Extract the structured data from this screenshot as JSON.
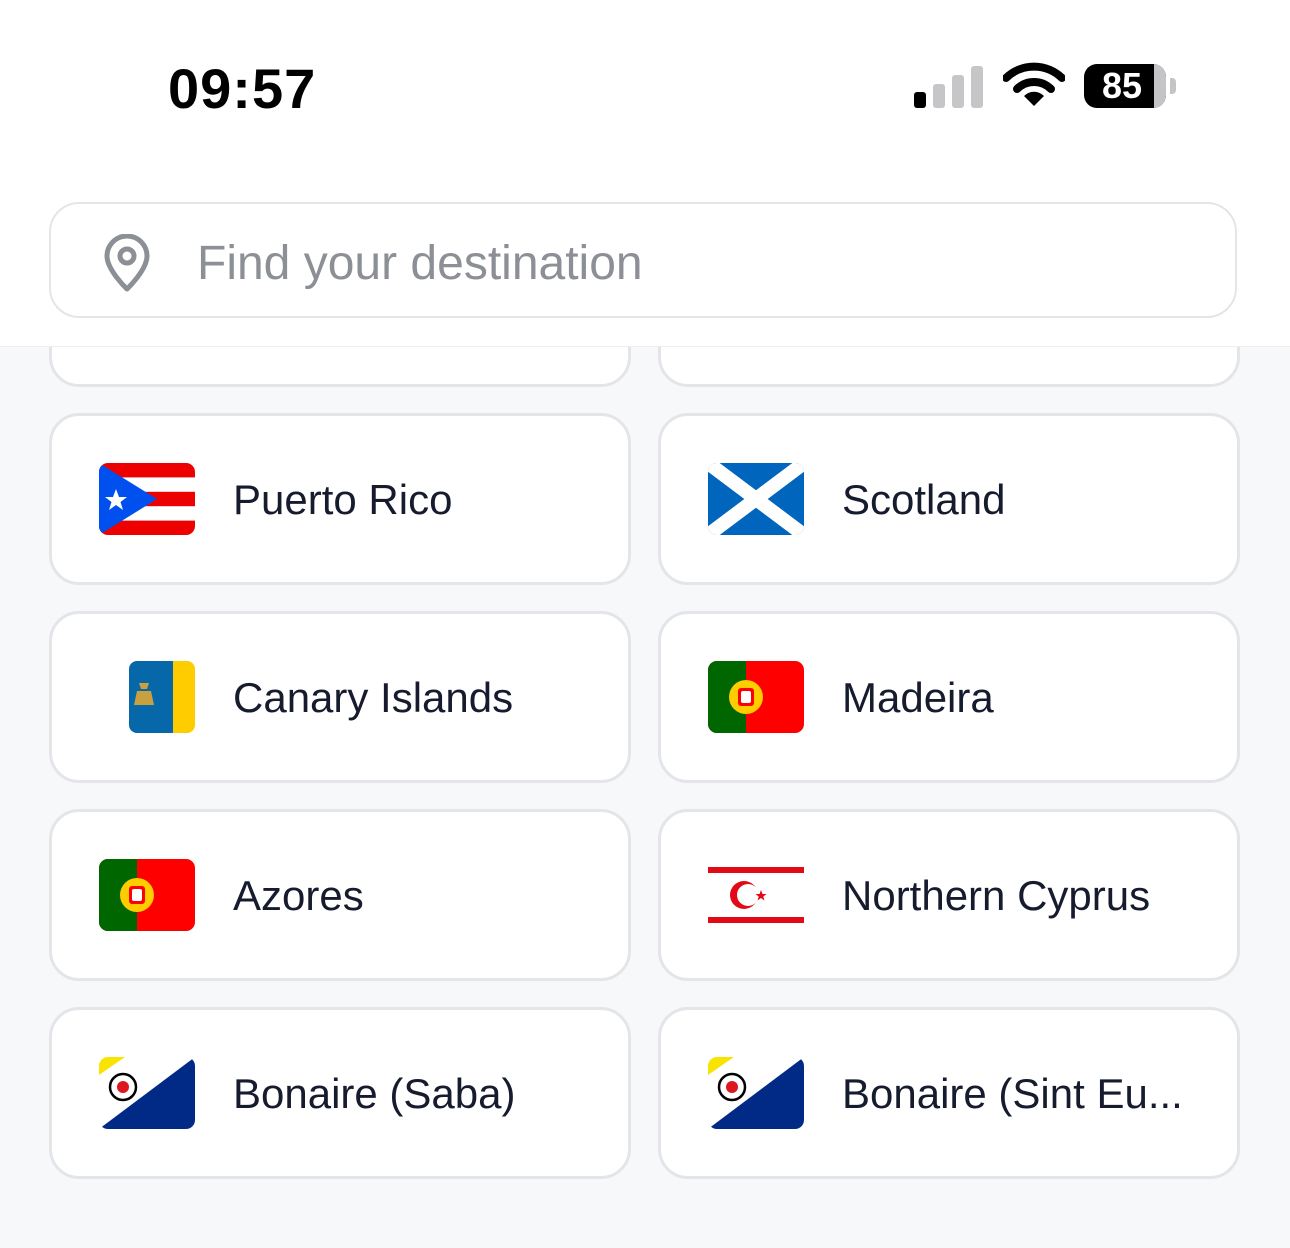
{
  "status_bar": {
    "time": "09:57",
    "battery_percent": "85",
    "signal_bars_active": 1,
    "signal_bars_total": 4
  },
  "search": {
    "placeholder": "Find your destination",
    "icon": "location-pin-icon"
  },
  "destinations": [
    {
      "name": "Puerto Rico",
      "flag": "puerto-rico-flag"
    },
    {
      "name": "Scotland",
      "flag": "scotland-flag"
    },
    {
      "name": "Canary Islands",
      "flag": "canary-islands-flag"
    },
    {
      "name": "Madeira",
      "flag": "madeira-flag"
    },
    {
      "name": "Azores",
      "flag": "azores-flag"
    },
    {
      "name": "Northern Cyprus",
      "flag": "northern-cyprus-flag"
    },
    {
      "name": "Bonaire (Saba)",
      "flag": "bonaire-flag"
    },
    {
      "name": "Bonaire (Sint Eu...",
      "flag": "bonaire-flag"
    }
  ],
  "colors": {
    "card_border": "#e3e5e9",
    "background": "#f7f8fa",
    "text": "#161b2e",
    "placeholder": "#8c8f96"
  }
}
